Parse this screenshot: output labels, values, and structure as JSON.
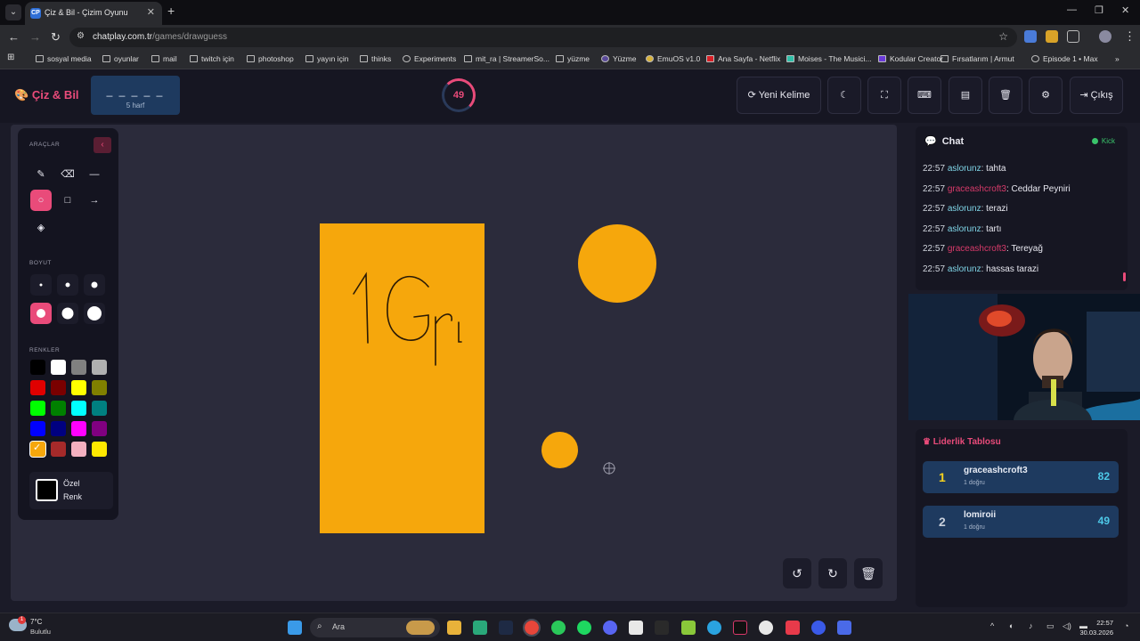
{
  "browser": {
    "tab_title": "Çiz & Bil - Çizim Oyunu",
    "tab_favicon": "CP",
    "url_host": "chatplay.com.tr",
    "url_path": "/games/drawguess",
    "bookmarks": [
      "sosyal media",
      "oyunlar",
      "mail",
      "twitch için",
      "photoshop",
      "yayın için",
      "thinks",
      "Experiments",
      "mit_ra | StreamerSo...",
      "yüzme",
      "Yüzme",
      "EmuOS v1.0",
      "Ana Sayfa - Netflix",
      "Moises - The Musici...",
      "Kodular Creator",
      "Fırsatlarım | Armut",
      "Episode 1 • Max"
    ]
  },
  "app": {
    "logo": "Çiz & Bil",
    "word_blanks": "_ _ _ _ _",
    "word_hint": "5 harf",
    "timer": "49",
    "buttons": {
      "new_word": "Yeni Kelime",
      "exit": "Çıkış"
    }
  },
  "toolbox": {
    "tools_label": "ARAÇLAR",
    "size_label": "BOYUT",
    "colors_label": "RENKLER",
    "custom_color_label": "Özel Renk",
    "colors": [
      "#000000",
      "#ffffff",
      "#808080",
      "#b0b0b0",
      "#e00000",
      "#7a0000",
      "#ffff00",
      "#808000",
      "#00ff00",
      "#008000",
      "#00ffff",
      "#008080",
      "#0000ff",
      "#000080",
      "#ff00ff",
      "#800080",
      "#f6a70c",
      "#a52a2a",
      "#f4b0c0",
      "#ffe800"
    ],
    "selected_color": "#f6a70c",
    "accent": "#e94b7a"
  },
  "canvas": {
    "drawing_color": "#f6a70c",
    "scribble_text": "1Gr"
  },
  "chat": {
    "title": "Chat",
    "platform": "Kick",
    "messages": [
      {
        "time": "22:57",
        "user": "aslorunz",
        "text": ": tahta"
      },
      {
        "time": "22:57",
        "user": "graceashcroft3",
        "text": ": Ceddar Peyniri"
      },
      {
        "time": "22:57",
        "user": "aslorunz",
        "text": ": terazi"
      },
      {
        "time": "22:57",
        "user": "aslorunz",
        "text": ": tartı"
      },
      {
        "time": "22:57",
        "user": "graceashcroft3",
        "text": ": Tereyağ"
      },
      {
        "time": "22:57",
        "user": "aslorunz",
        "text": ": hassas tarazi"
      }
    ]
  },
  "leaderboard": {
    "title": "Liderlik Tablosu",
    "rows": [
      {
        "rank": "1",
        "name": "graceashcroft3",
        "sub": "1 doğru",
        "score": "82"
      },
      {
        "rank": "2",
        "name": "lomiroii",
        "sub": "1 doğru",
        "score": "49"
      }
    ]
  },
  "taskbar": {
    "weather_temp": "7°C",
    "weather_desc": "Bulutlu",
    "weather_badge": "1",
    "search": "Ara",
    "time": "22:57",
    "date": "30.03.2026"
  }
}
